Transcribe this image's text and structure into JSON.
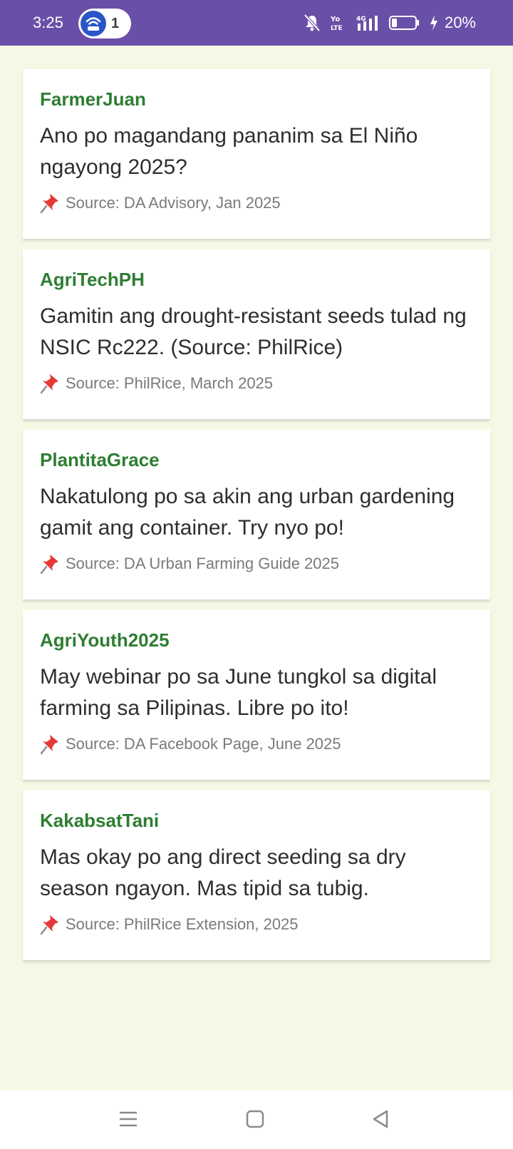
{
  "status_bar": {
    "time": "3:25",
    "hotspot_count": "1",
    "battery": "20%",
    "icons": [
      "hotspot-icon",
      "bell-off-icon",
      "volte-icon",
      "signal-4g-icon",
      "battery-icon",
      "charging-icon"
    ]
  },
  "posts": [
    {
      "author": "FarmerJuan",
      "body": "Ano po magandang pananim sa El Niño ngayong 2025?",
      "source": "Source: DA Advisory, Jan 2025"
    },
    {
      "author": "AgriTechPH",
      "body": "Gamitin ang drought-resistant seeds tulad ng NSIC Rc222. (Source: PhilRice)",
      "source": "Source: PhilRice, March 2025"
    },
    {
      "author": "PlantitaGrace",
      "body": "Nakatulong po sa akin ang urban gardening gamit ang container. Try nyo po!",
      "source": "Source: DA Urban Farming Guide 2025"
    },
    {
      "author": "AgriYouth2025",
      "body": "May webinar po sa June tungkol sa digital farming sa Pilipinas. Libre po ito!",
      "source": "Source: DA Facebook Page, June 2025"
    },
    {
      "author": "KakabsatTani",
      "body": "Mas okay po ang direct seeding sa dry season ngayon. Mas tipid sa tubig.",
      "source": "Source: PhilRice Extension, 2025"
    }
  ],
  "colors": {
    "status_bar": "#6a4fa8",
    "background": "#f6f8e5",
    "author": "#2e7d32",
    "pin": "#e53935"
  },
  "nav_bar": {
    "icons": [
      "menu-icon",
      "home-square-icon",
      "back-triangle-icon"
    ]
  }
}
